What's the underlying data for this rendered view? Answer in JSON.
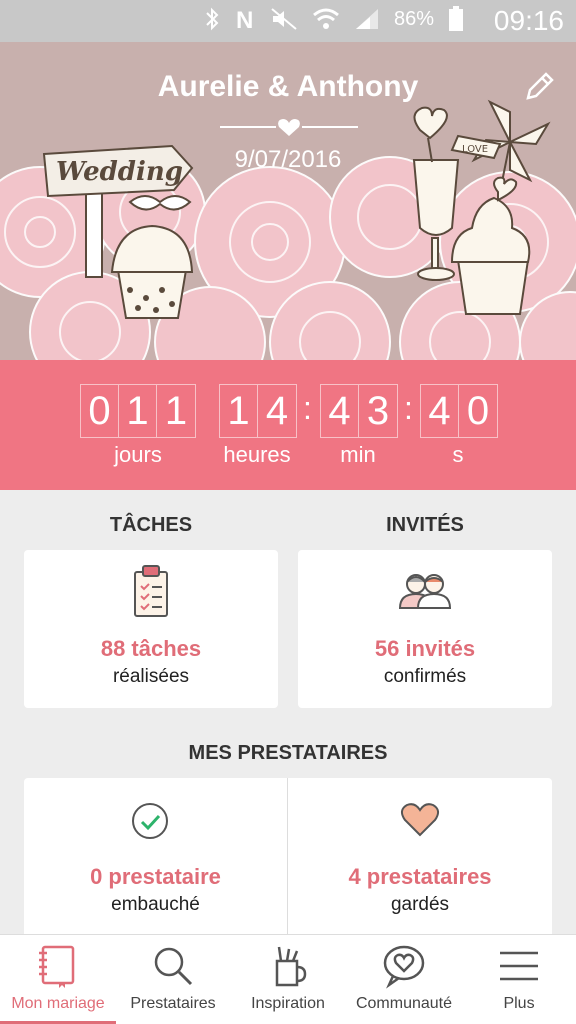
{
  "status_bar": {
    "battery_percent": "86%",
    "time": "09:16",
    "icons": [
      "bluetooth-icon",
      "nfc-icon",
      "mute-icon",
      "wifi-icon",
      "signal-icon",
      "battery-icon"
    ]
  },
  "header": {
    "couple_names": "Aurelie & Anthony",
    "wedding_date": "9/07/2016",
    "edit_icon": "pencil-icon"
  },
  "countdown": {
    "days": [
      "0",
      "1",
      "1"
    ],
    "hours": [
      "1",
      "4"
    ],
    "minutes": [
      "4",
      "3"
    ],
    "seconds": [
      "4",
      "0"
    ],
    "separator": ":",
    "labels": {
      "days": "jours",
      "hours": "heures",
      "minutes": "min",
      "seconds": "s"
    }
  },
  "tasks": {
    "title": "TÂCHES",
    "count_text": "88 tâches",
    "status_text": "réalisées",
    "icon": "clipboard-icon"
  },
  "guests": {
    "title": "INVITÉS",
    "count_text": "56 invités",
    "status_text": "confirmés",
    "icon": "guests-icon"
  },
  "vendors": {
    "title": "MES PRESTATAIRES",
    "hired": {
      "count_text": "0 prestataire",
      "status_text": "embauché",
      "icon": "check-circle-icon"
    },
    "saved": {
      "count_text": "4 prestataires",
      "status_text": "gardés",
      "icon": "heart-icon"
    }
  },
  "bottom_nav": {
    "items": [
      {
        "label": "Mon mariage",
        "icon": "notebook-icon",
        "active": true
      },
      {
        "label": "Prestataires",
        "icon": "search-icon",
        "active": false
      },
      {
        "label": "Inspiration",
        "icon": "pencil-cup-icon",
        "active": false
      },
      {
        "label": "Communauté",
        "icon": "chat-heart-icon",
        "active": false
      },
      {
        "label": "Plus",
        "icon": "menu-icon",
        "active": false
      }
    ]
  },
  "colors": {
    "accent": "#f07583",
    "accent_text": "#e06d78",
    "banner_bg": "#c8b0ad",
    "flower_pink": "#f5c6cc"
  }
}
